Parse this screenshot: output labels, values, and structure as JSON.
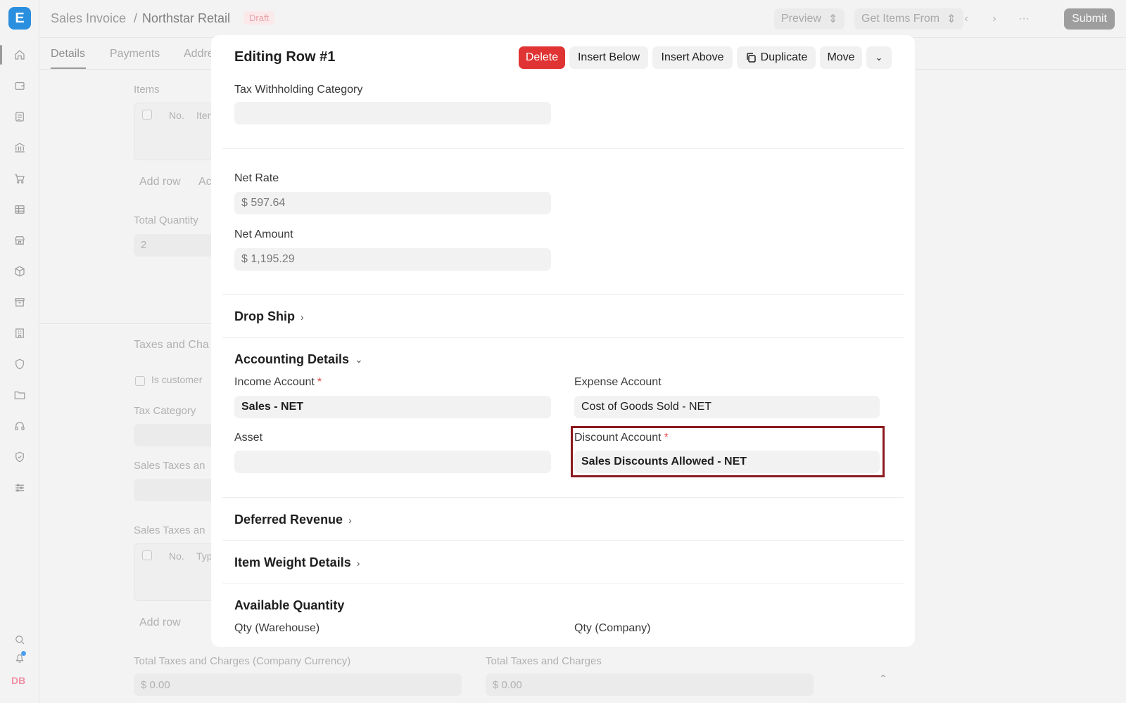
{
  "app": {
    "logo_letter": "E",
    "user_initials": "DB"
  },
  "breadcrumb": {
    "doctype": "Sales Invoice",
    "separator": "/",
    "record": "Northstar Retail",
    "status": "Draft"
  },
  "toolbar": {
    "preview": "Preview",
    "get_items": "Get Items From",
    "more": "···",
    "submit": "Submit",
    "prev": "‹",
    "next": "›"
  },
  "sidebar_icons": [
    "home-icon",
    "wallet-icon",
    "document-icon",
    "bank-icon",
    "cart-icon",
    "table-icon",
    "store-icon",
    "package-icon",
    "archive-icon",
    "building-icon",
    "shield-icon",
    "folder-icon",
    "headset-icon",
    "badge-icon",
    "sliders-icon",
    "search-icon",
    "bell-icon"
  ],
  "background": {
    "tabs": [
      "Details",
      "Payments",
      "Addre"
    ],
    "items_label": "Items",
    "items_cols": [
      "No.",
      "Iten"
    ],
    "add_row": "Add row",
    "add_row_trunc": "Ac",
    "total_qty_label": "Total Quantity",
    "total_qty_value": "2",
    "taxes_label": "Taxes and Cha",
    "is_customer": "Is customer",
    "tax_category": "Tax Category",
    "sales_taxes_1": "Sales Taxes an",
    "sales_taxes_2": "Sales Taxes an",
    "taxes_cols": [
      "No.",
      "Typ"
    ],
    "add_row_2": "Add row",
    "total_taxes_company": "Total Taxes and Charges (Company Currency)",
    "total_taxes_company_value": "$ 0.00",
    "total_taxes": "Total Taxes and Charges",
    "total_taxes_value": "$ 0.00"
  },
  "modal": {
    "title": "Editing Row #1",
    "buttons": {
      "delete": "Delete",
      "insert_below": "Insert Below",
      "insert_above": "Insert Above",
      "duplicate": "Duplicate",
      "move": "Move"
    },
    "tax_withholding_label": "Tax Withholding Category",
    "tax_withholding_value": "",
    "net_rate_label": "Net Rate",
    "net_rate_value": "$ 597.64",
    "net_amount_label": "Net Amount",
    "net_amount_value": "$ 1,195.29",
    "drop_ship": "Drop Ship",
    "accounting": {
      "title": "Accounting Details",
      "income_label": "Income Account",
      "income_value": "Sales - NET",
      "expense_label": "Expense Account",
      "expense_value": "Cost of Goods Sold - NET",
      "asset_label": "Asset",
      "asset_value": "",
      "discount_label": "Discount Account",
      "discount_value": "Sales Discounts Allowed - NET",
      "required_mark": "*"
    },
    "deferred_revenue": "Deferred Revenue",
    "item_weight": "Item Weight Details",
    "available_qty": {
      "title": "Available Quantity",
      "warehouse_label": "Qty (Warehouse)",
      "company_label": "Qty (Company)"
    }
  },
  "colors": {
    "danger": "#e03333",
    "highlight": "#8b1a1f",
    "logo": "#2b8fe0",
    "required": "#e24c4c"
  }
}
